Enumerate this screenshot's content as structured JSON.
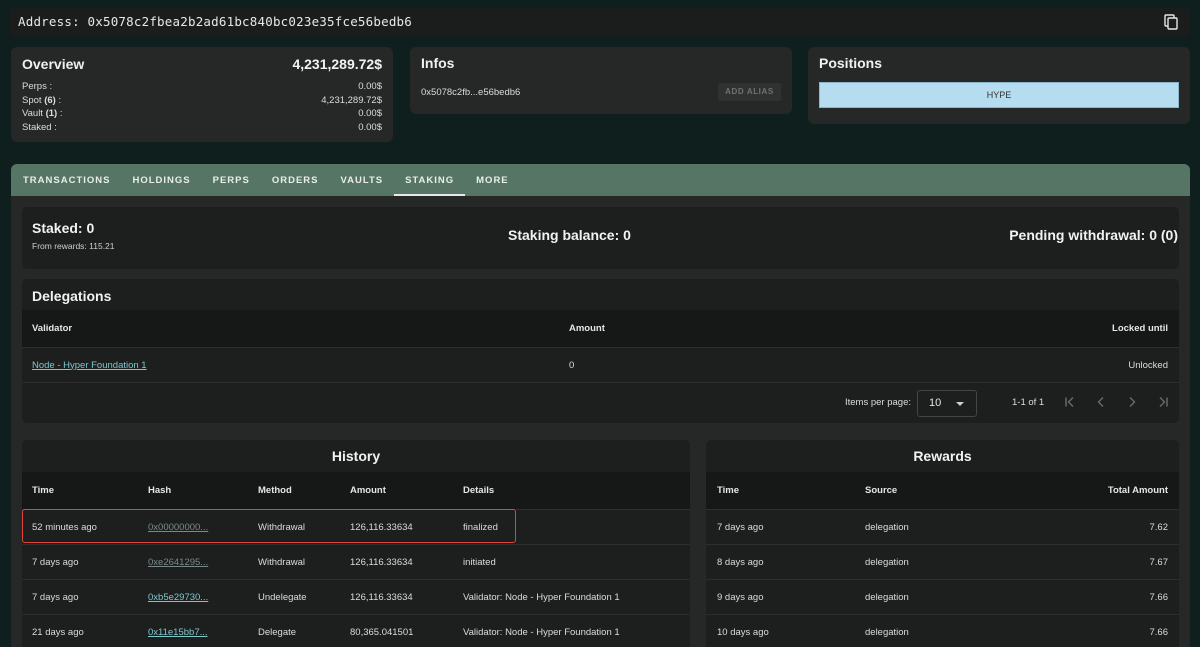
{
  "address": {
    "text": "Address: 0x5078c2fbea2b2ad61bc840bc023e35fce56bedb6",
    "copy_icon": "copy-icon"
  },
  "overview": {
    "title": "Overview",
    "total": "4,231,289.72$",
    "rows": [
      {
        "label_pre": "Perps :",
        "count": "",
        "label_post": "",
        "value": "0.00$"
      },
      {
        "label_pre": "Spot ",
        "count": "(6)",
        "label_post": " :",
        "value": "4,231,289.72$"
      },
      {
        "label_pre": "Vault ",
        "count": "(1)",
        "label_post": " :",
        "value": "0.00$"
      },
      {
        "label_pre": "Staked :",
        "count": "",
        "label_post": "",
        "value": "0.00$"
      }
    ]
  },
  "infos": {
    "title": "Infos",
    "short_address": "0x5078c2fb...e56bedb6",
    "alias_button": "ADD ALIAS"
  },
  "positions": {
    "title": "Positions",
    "bar_label": "HYPE",
    "bar_color": "#b5dcef"
  },
  "tabs": [
    {
      "label": "TRANSACTIONS",
      "active": false
    },
    {
      "label": "HOLDINGS",
      "active": false
    },
    {
      "label": "PERPS",
      "active": false
    },
    {
      "label": "ORDERS",
      "active": false
    },
    {
      "label": "VAULTS",
      "active": false
    },
    {
      "label": "STAKING",
      "active": true
    },
    {
      "label": "MORE",
      "active": false
    }
  ],
  "staking": {
    "staked": "Staked: 0",
    "from_rewards": "From rewards: 115.21",
    "balance": "Staking balance: 0",
    "pending": "Pending withdrawal: 0 (0)"
  },
  "delegations": {
    "title": "Delegations",
    "columns": [
      "Validator",
      "Amount",
      "Locked until"
    ],
    "rows": [
      {
        "validator": "Node - Hyper Foundation 1",
        "amount": "0",
        "locked": "Unlocked"
      }
    ],
    "pager": {
      "items_per_page_label": "Items per page:",
      "items_per_page_value": "10",
      "range": "1-1 of 1"
    }
  },
  "history": {
    "title": "History",
    "columns": [
      "Time",
      "Hash",
      "Method",
      "Amount",
      "Details"
    ],
    "rows": [
      {
        "time": "52 minutes ago",
        "hash": "0x00000000...",
        "method": "Withdrawal",
        "amount": "126,116.33634",
        "details": "finalized"
      },
      {
        "time": "7 days ago",
        "hash": "0xe2641295...",
        "method": "Withdrawal",
        "amount": "126,116.33634",
        "details": "initiated"
      },
      {
        "time": "7 days ago",
        "hash": "0xb5e29730...",
        "method": "Undelegate",
        "amount": "126,116.33634",
        "details": "Validator: Node - Hyper Foundation 1"
      },
      {
        "time": "21 days ago",
        "hash": "0x11e15bb7...",
        "method": "Delegate",
        "amount": "80,365.041501",
        "details": "Validator: Node - Hyper Foundation 1"
      }
    ]
  },
  "rewards": {
    "title": "Rewards",
    "columns": [
      "Time",
      "Source",
      "Total Amount"
    ],
    "rows": [
      {
        "time": "7 days ago",
        "source": "delegation",
        "amount": "7.62"
      },
      {
        "time": "8 days ago",
        "source": "delegation",
        "amount": "7.67"
      },
      {
        "time": "9 days ago",
        "source": "delegation",
        "amount": "7.66"
      },
      {
        "time": "10 days ago",
        "source": "delegation",
        "amount": "7.66"
      }
    ]
  },
  "colors": {
    "background": "#0e1f1d",
    "tabbar": "#567565",
    "link": "#7fc7cc",
    "highlight": "#e0453a"
  }
}
